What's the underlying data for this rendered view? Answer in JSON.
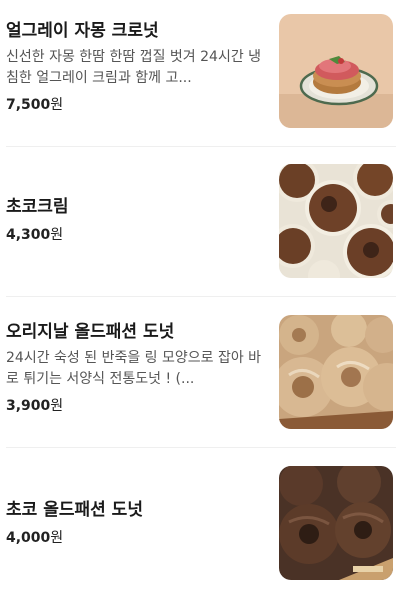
{
  "menu": {
    "currency_suffix": "원",
    "items": [
      {
        "name": "얼그레이 자몽 크로넛",
        "description": "신선한 자몽 한땀 한땀 껍질 벗겨 24시간 냉침한 얼그레이 크림과 함께 고...",
        "price": "7,500",
        "image_icon": "earl-grey-grapefruit-cronut-photo"
      },
      {
        "name": "초코크림",
        "description": "",
        "price": "4,300",
        "image_icon": "choco-cream-donut-photo"
      },
      {
        "name": "오리지날 올드패션 도넛",
        "description": "24시간 숙성 된 반죽을 링 모양으로 잡아 바로 튀기는 서양식 전통도넛 ! (...",
        "price": "3,900",
        "image_icon": "original-old-fashioned-donut-photo"
      },
      {
        "name": "초코 올드패션 도넛",
        "description": "",
        "price": "4,000",
        "image_icon": "choco-old-fashioned-donut-photo"
      }
    ]
  },
  "colors": {
    "text_primary": "#1a1a1a",
    "text_secondary": "#555555",
    "divider": "#efefef"
  }
}
